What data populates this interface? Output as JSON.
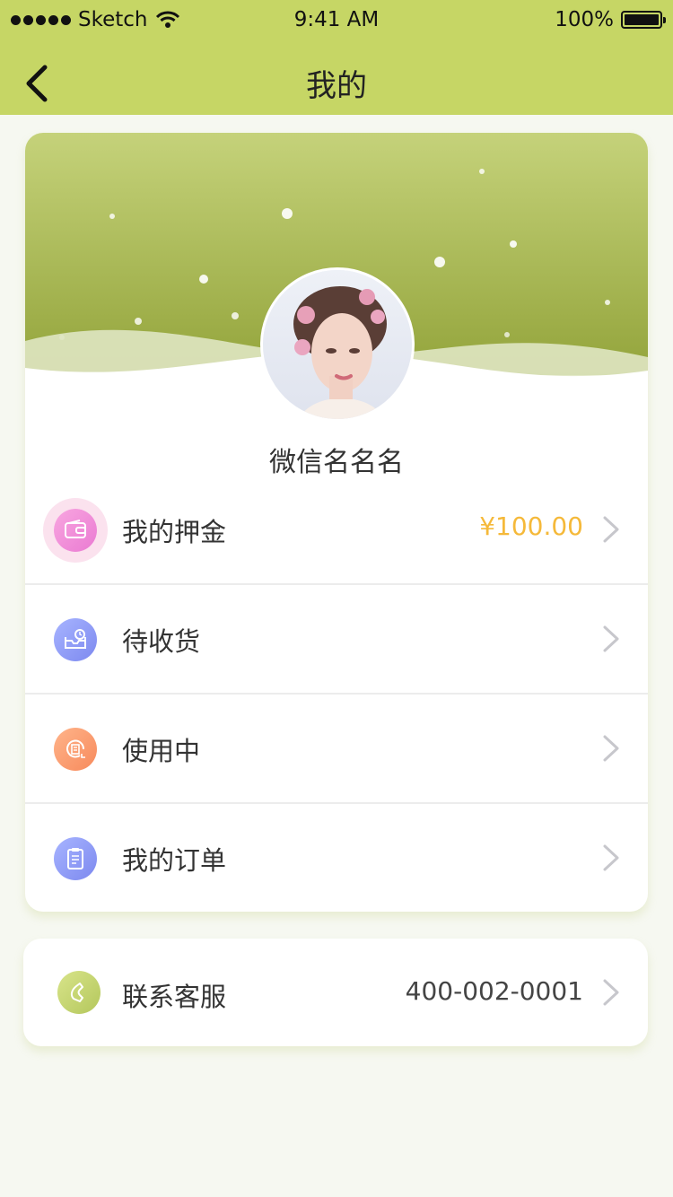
{
  "status_bar": {
    "carrier": "Sketch",
    "time": "9:41 AM",
    "battery": "100%"
  },
  "nav": {
    "title": "我的",
    "back_icon": "chevron-left-icon"
  },
  "profile": {
    "username": "微信名名名"
  },
  "menu": [
    {
      "label": "我的押金",
      "value": "¥100.00",
      "icon": "wallet-icon"
    },
    {
      "label": "待收货",
      "value": "",
      "icon": "inbox-clock-icon"
    },
    {
      "label": "使用中",
      "value": "",
      "icon": "document-icon"
    },
    {
      "label": "我的订单",
      "value": "",
      "icon": "clipboard-icon"
    }
  ],
  "contact": {
    "label": "联系客服",
    "value": "400-002-0001",
    "icon": "phone-icon"
  },
  "colors": {
    "nav_bg": "#c6d665",
    "accent_price": "#f5b93a",
    "hero_top": "#c5d27a",
    "hero_bottom": "#93a43b"
  }
}
